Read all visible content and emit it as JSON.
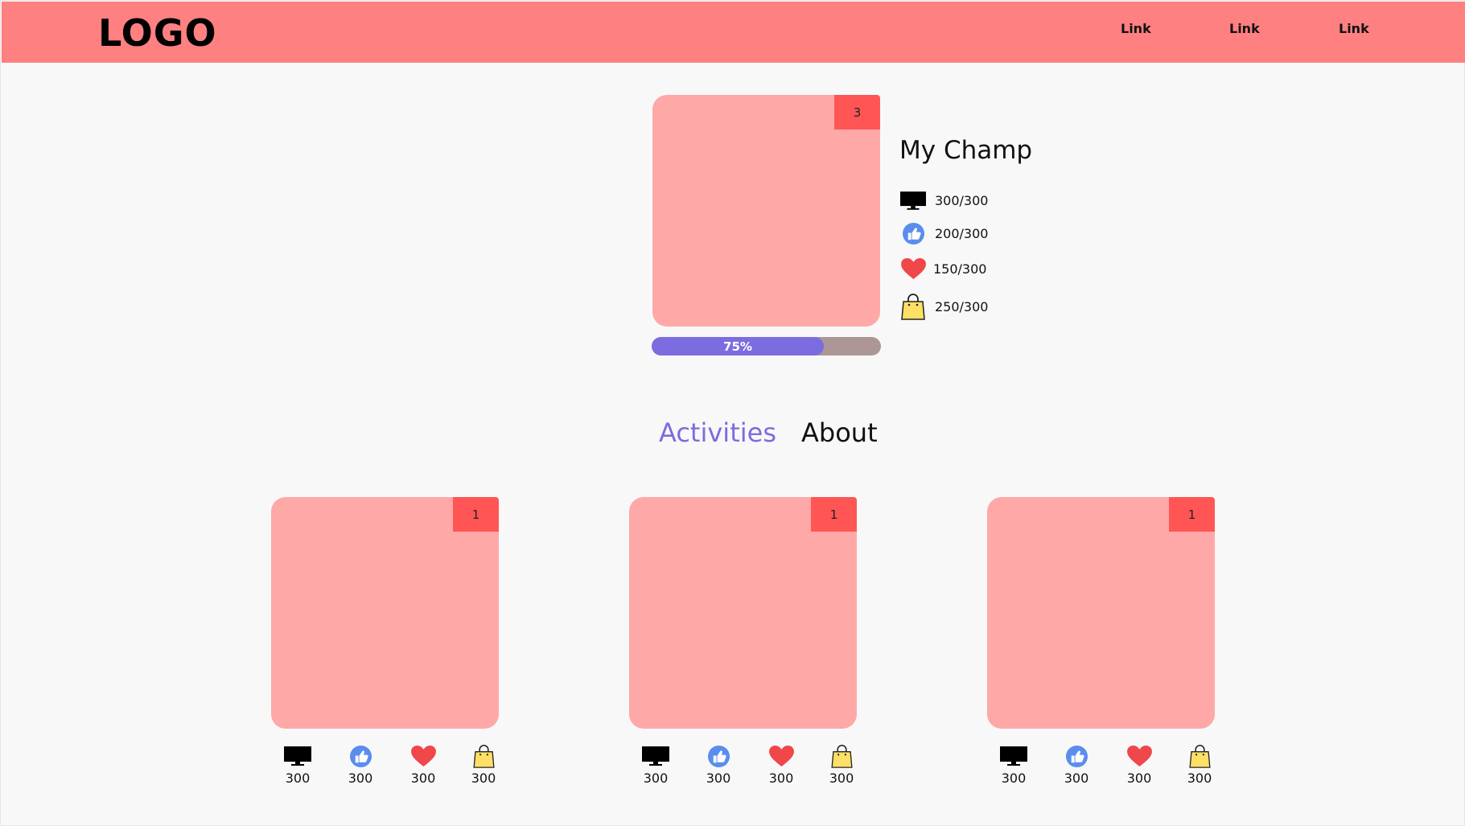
{
  "header": {
    "logo": "LOGO",
    "links": [
      "Link",
      "Link",
      "Link"
    ]
  },
  "champ": {
    "badge": "3",
    "title": "My Champ",
    "progress_label": "75%",
    "progress_value": 0.75,
    "stats": [
      {
        "icon": "monitor-icon",
        "value": "300/300"
      },
      {
        "icon": "thumbs-up-icon",
        "value": "200/300"
      },
      {
        "icon": "heart-icon",
        "value": "150/300"
      },
      {
        "icon": "shopping-bag-icon",
        "value": "250/300"
      }
    ]
  },
  "tabs": {
    "activities": "Activities",
    "about": "About",
    "active": "activities"
  },
  "activities": [
    {
      "badge": "1",
      "stats": [
        "300",
        "300",
        "300",
        "300"
      ]
    },
    {
      "badge": "1",
      "stats": [
        "300",
        "300",
        "300",
        "300"
      ]
    },
    {
      "badge": "1",
      "stats": [
        "300",
        "300",
        "300",
        "300"
      ]
    }
  ],
  "colors": {
    "header": "#ff8080",
    "card": "#ffa8a8",
    "badge": "#ff5555",
    "accent": "#7b6ce0",
    "progress_track": "#ac9696"
  }
}
